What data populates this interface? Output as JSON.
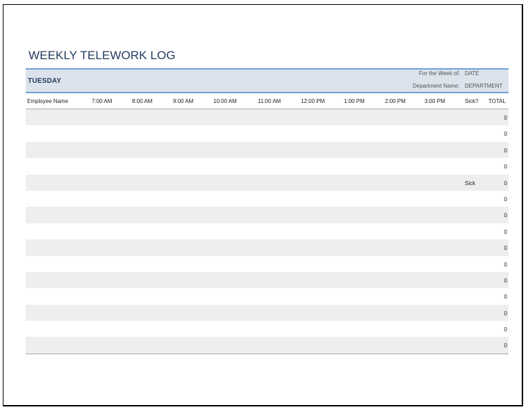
{
  "title": "WEEKLY TELEWORK LOG",
  "day": "TUESDAY",
  "week_label": "For the Week of:",
  "week_value": "DATE",
  "department_label": "Department Name:",
  "department_value": "DEPARTMENT",
  "columns": [
    "Employee Name",
    "7:00 AM",
    "8:00 AM",
    "9:00 AM",
    "10:00 AM",
    "11:00 AM",
    "12:00 PM",
    "1:00 PM",
    "2:00 PM",
    "3:00 PM",
    "Sick?",
    "TOTAL"
  ],
  "rows": [
    {
      "sick": "",
      "total": "0"
    },
    {
      "sick": "",
      "total": "0"
    },
    {
      "sick": "",
      "total": "0"
    },
    {
      "sick": "",
      "total": "0"
    },
    {
      "sick": "Sick",
      "total": "0"
    },
    {
      "sick": "",
      "total": "0"
    },
    {
      "sick": "",
      "total": "0"
    },
    {
      "sick": "",
      "total": "0"
    },
    {
      "sick": "",
      "total": "0"
    },
    {
      "sick": "",
      "total": "0"
    },
    {
      "sick": "",
      "total": "0"
    },
    {
      "sick": "",
      "total": "0"
    },
    {
      "sick": "",
      "total": "0"
    },
    {
      "sick": "",
      "total": "0"
    },
    {
      "sick": "",
      "total": "0"
    }
  ],
  "colors": {
    "title": "#243a5e",
    "band": "#dce3ec",
    "band_border": "#6f9fd8",
    "row_shade": "#eeeeee"
  }
}
